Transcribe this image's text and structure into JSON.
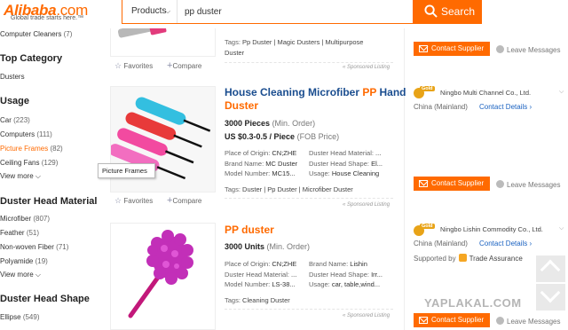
{
  "header": {
    "logo_text": "Alibaba",
    "logo_suffix": ".com",
    "tagline": "Global trade starts here.™",
    "search_category": "Products",
    "search_value": "pp duster",
    "search_button": "Search"
  },
  "sidebar": {
    "top_item": {
      "label": "Computer Cleaners",
      "count": "(7)"
    },
    "top_category_title": "Top Category",
    "top_category_items": [
      {
        "label": "Dusters",
        "count": ""
      }
    ],
    "usage_title": "Usage",
    "usage_items": [
      {
        "label": "Car",
        "count": "(223)"
      },
      {
        "label": "Computers",
        "count": "(111)"
      },
      {
        "label": "Picture Frames",
        "count": "(82)"
      },
      {
        "label": "Ceiling Fans",
        "count": "(129)"
      }
    ],
    "view_more": "View more",
    "duster_head_material_title": "Duster Head Material",
    "duster_head_material_items": [
      {
        "label": "Microfiber",
        "count": "(807)"
      },
      {
        "label": "Feather",
        "count": "(51)"
      },
      {
        "label": "Non-woven Fiber",
        "count": "(71)"
      },
      {
        "label": "Polyamide",
        "count": "(19)"
      }
    ],
    "duster_head_shape_title": "Duster Head Shape",
    "duster_head_shape_items": [
      {
        "label": "Ellipse",
        "count": "(549)"
      }
    ],
    "tooltip": "Picture Frames"
  },
  "products": [
    {
      "tags_label": "Tags:",
      "tags": "Pp Duster | Magic Dusters | Multipurpose",
      "tags_line2": "Duster",
      "sponsored": "« Sponsored Listing",
      "favorites": "Favorites",
      "compare": "Compare",
      "contact": "Contact Supplier",
      "leave": "Leave Messages"
    },
    {
      "title_a": "House Cleaning Microfiber ",
      "title_kw": "PP",
      "title_b": " Hand",
      "title_line2": "Duster",
      "qty": "3000 Pieces",
      "qty_sub": "(Min. Order)",
      "price": "US $0.3-0.5 / Piece",
      "price_sub": "(FOB Price)",
      "attrs": [
        {
          "k": "Place of Origin:",
          "v": "CN;ZHE"
        },
        {
          "k": "Duster Head Material:",
          "v": "..."
        },
        {
          "k": "Brand Name:",
          "v": "MC Duster"
        },
        {
          "k": "Duster Head Shape:",
          "v": "El..."
        },
        {
          "k": "Model Number:",
          "v": "MC15..."
        },
        {
          "k": "Usage:",
          "v": "House Cleaning"
        }
      ],
      "tags_label": "Tags:",
      "tags": "Duster | Pp Duster | Microfiber Duster",
      "sponsored": "« Sponsored Listing",
      "favorites": "Favorites",
      "compare": "Compare",
      "gold": "Gold",
      "supplier": "Ningbo Multi Channel Co., Ltd.",
      "country": "China (Mainland)",
      "details": "Contact Details ›",
      "contact": "Contact Supplier",
      "leave": "Leave Messages"
    },
    {
      "title": "PP duster",
      "qty": "3000 Units",
      "qty_sub": "(Min. Order)",
      "attrs": [
        {
          "k": "Place of Origin:",
          "v": "CN;ZHE"
        },
        {
          "k": "Brand Name:",
          "v": "Lishin"
        },
        {
          "k": "Duster Head Material:",
          "v": "..."
        },
        {
          "k": "Duster Head Shape:",
          "v": "Irr..."
        },
        {
          "k": "Model Number:",
          "v": "LS-38..."
        },
        {
          "k": "Usage:",
          "v": "car, table,wind..."
        }
      ],
      "tags_label": "Tags:",
      "tags": "Cleaning Duster",
      "sponsored": "« Sponsored Listing",
      "gold": "Gold",
      "supplier": "Ningbo Lishin Commodity Co., Ltd.",
      "country": "China (Mainland)",
      "details": "Contact Details ›",
      "supported_by": "Supported by",
      "trade_assurance": "Trade Assurance",
      "contact": "Contact Supplier",
      "leave": "Leave Messages"
    }
  ],
  "watermark": "YAPLAKAL.COM",
  "colors": {
    "accent": "#ff6a00",
    "link": "#1a4d8f",
    "gold": "#e8a317"
  }
}
